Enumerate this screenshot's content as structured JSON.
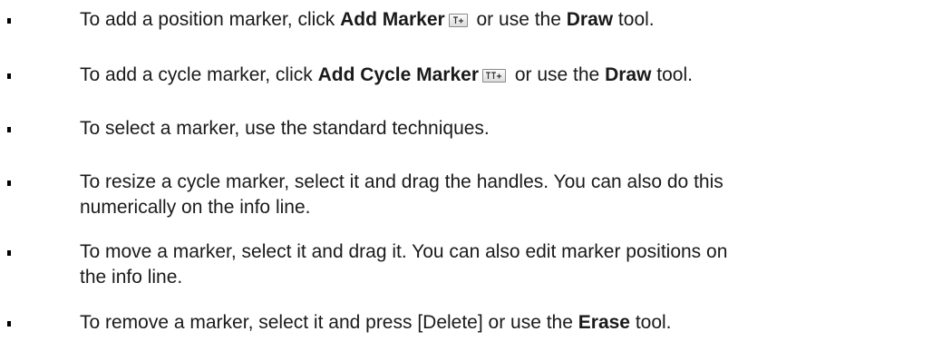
{
  "items": [
    {
      "pre": "To add a position marker, click ",
      "bold1": "Add Marker",
      "icon": "add-marker-icon",
      "mid": " or use the ",
      "bold2": "Draw",
      "post": " tool."
    },
    {
      "pre": "To add a cycle marker, click ",
      "bold1": "Add Cycle Marker",
      "icon": "add-cycle-marker-icon",
      "mid": " or use the ",
      "bold2": "Draw",
      "post": " tool."
    },
    {
      "text": "To select a marker, use the standard techniques."
    },
    {
      "line1": "To resize a cycle marker, select it and drag the handles. You can also do this",
      "line2": "numerically on the info line."
    },
    {
      "line1": "To move a marker, select it and drag it. You can also edit marker positions on",
      "line2": "the info line."
    },
    {
      "pre": "To remove a marker, select it and press [Delete] or use the ",
      "bold": "Erase",
      "post": " tool."
    }
  ]
}
